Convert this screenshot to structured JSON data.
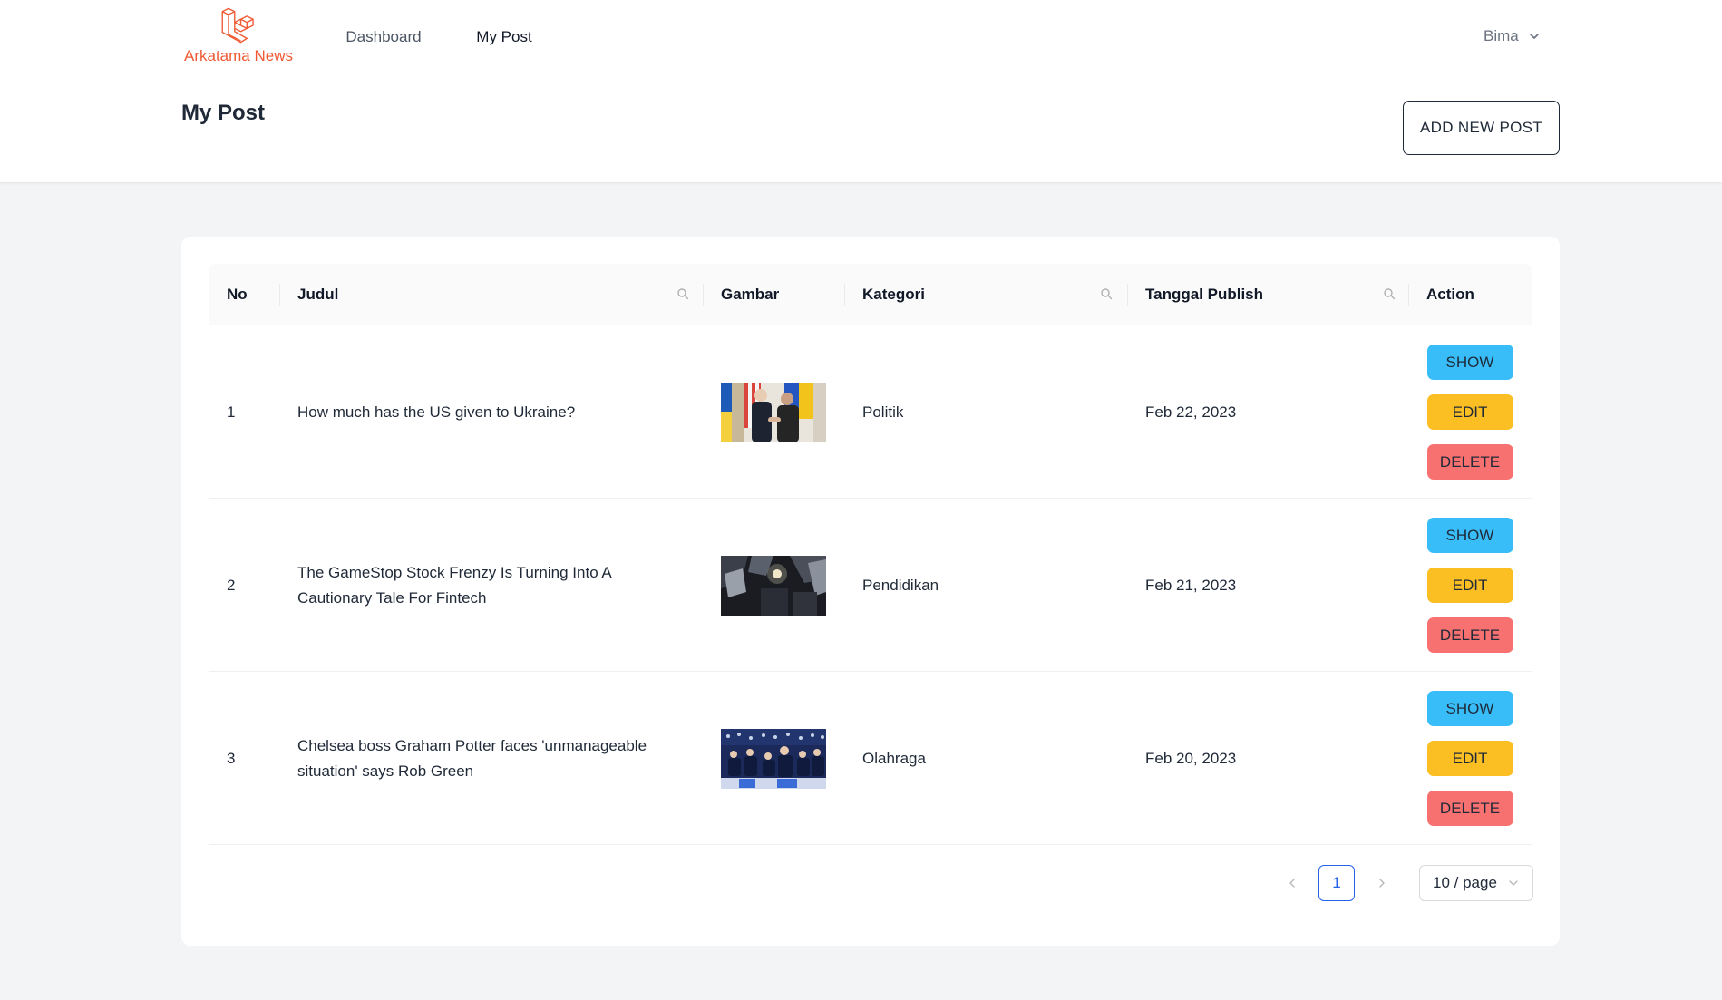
{
  "navbar": {
    "brand": "Arkatama News",
    "links": [
      {
        "label": "Dashboard",
        "active": false
      },
      {
        "label": "My Post",
        "active": true
      }
    ],
    "user": "Bima"
  },
  "header": {
    "title": "My Post",
    "add_button": "ADD NEW POST"
  },
  "table": {
    "columns": [
      "No",
      "Judul",
      "Gambar",
      "Kategori",
      "Tanggal Publish",
      "Action"
    ],
    "rows": [
      {
        "no": "1",
        "judul": "How much has the US given to Ukraine?",
        "kategori": "Politik",
        "tanggal": "Feb 22, 2023"
      },
      {
        "no": "2",
        "judul": "The GameStop Stock Frenzy Is Turning Into A Cautionary Tale For Fintech",
        "kategori": "Pendidikan",
        "tanggal": "Feb 21, 2023"
      },
      {
        "no": "3",
        "judul": "Chelsea boss Graham Potter faces 'unmanageable situation' says Rob Green",
        "kategori": "Olahraga",
        "tanggal": "Feb 20, 2023"
      }
    ],
    "actions": {
      "show": "SHOW",
      "edit": "EDIT",
      "delete": "DELETE"
    }
  },
  "pagination": {
    "current_page": "1",
    "page_size": "10 / page"
  },
  "colors": {
    "brand": "#ef5a34",
    "active_tab": "#818cf8",
    "show": "#38bdf8",
    "edit": "#fbbf24",
    "delete": "#f87171",
    "page_active": "#2563eb"
  }
}
